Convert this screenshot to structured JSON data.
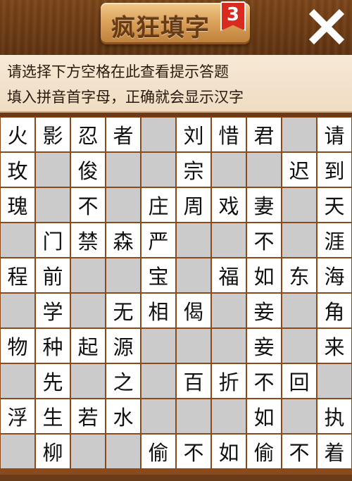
{
  "header": {
    "title": "疯狂填字",
    "level": "3",
    "close_icon": "close-x-icon"
  },
  "hints": {
    "line1": "请选择下方空格在此查看提示答题",
    "line2": "填入拼音首字母，正确就会显示汉字"
  },
  "colors": {
    "wood": "#6b3a17",
    "cell_filled": "#ffffff",
    "cell_empty": "#cbcbcb",
    "badge": "#d92a1f"
  },
  "grid": [
    [
      "火",
      "影",
      "忍",
      "者",
      "",
      "刘",
      "惜",
      "君",
      "",
      "请"
    ],
    [
      "玫",
      "",
      "俊",
      "",
      "",
      "宗",
      "",
      "",
      "迟",
      "到"
    ],
    [
      "瑰",
      "",
      "不",
      "",
      "庄",
      "周",
      "戏",
      "妻",
      "",
      "天"
    ],
    [
      "",
      "门",
      "禁",
      "森",
      "严",
      "",
      "",
      "不",
      "",
      "涯"
    ],
    [
      "程",
      "前",
      "",
      "",
      "宝",
      "",
      "福",
      "如",
      "东",
      "海"
    ],
    [
      "",
      "学",
      "",
      "无",
      "相",
      "偈",
      "",
      "妾",
      "",
      "角"
    ],
    [
      "物",
      "种",
      "起",
      "源",
      "",
      "",
      "",
      "妾",
      "",
      "来"
    ],
    [
      "",
      "先",
      "",
      "之",
      "",
      "百",
      "折",
      "不",
      "回",
      ""
    ],
    [
      "浮",
      "生",
      "若",
      "水",
      "",
      "",
      "",
      "如",
      "",
      "执"
    ],
    [
      "",
      "柳",
      "",
      "",
      "偷",
      "不",
      "如",
      "偷",
      "不",
      "着"
    ]
  ]
}
